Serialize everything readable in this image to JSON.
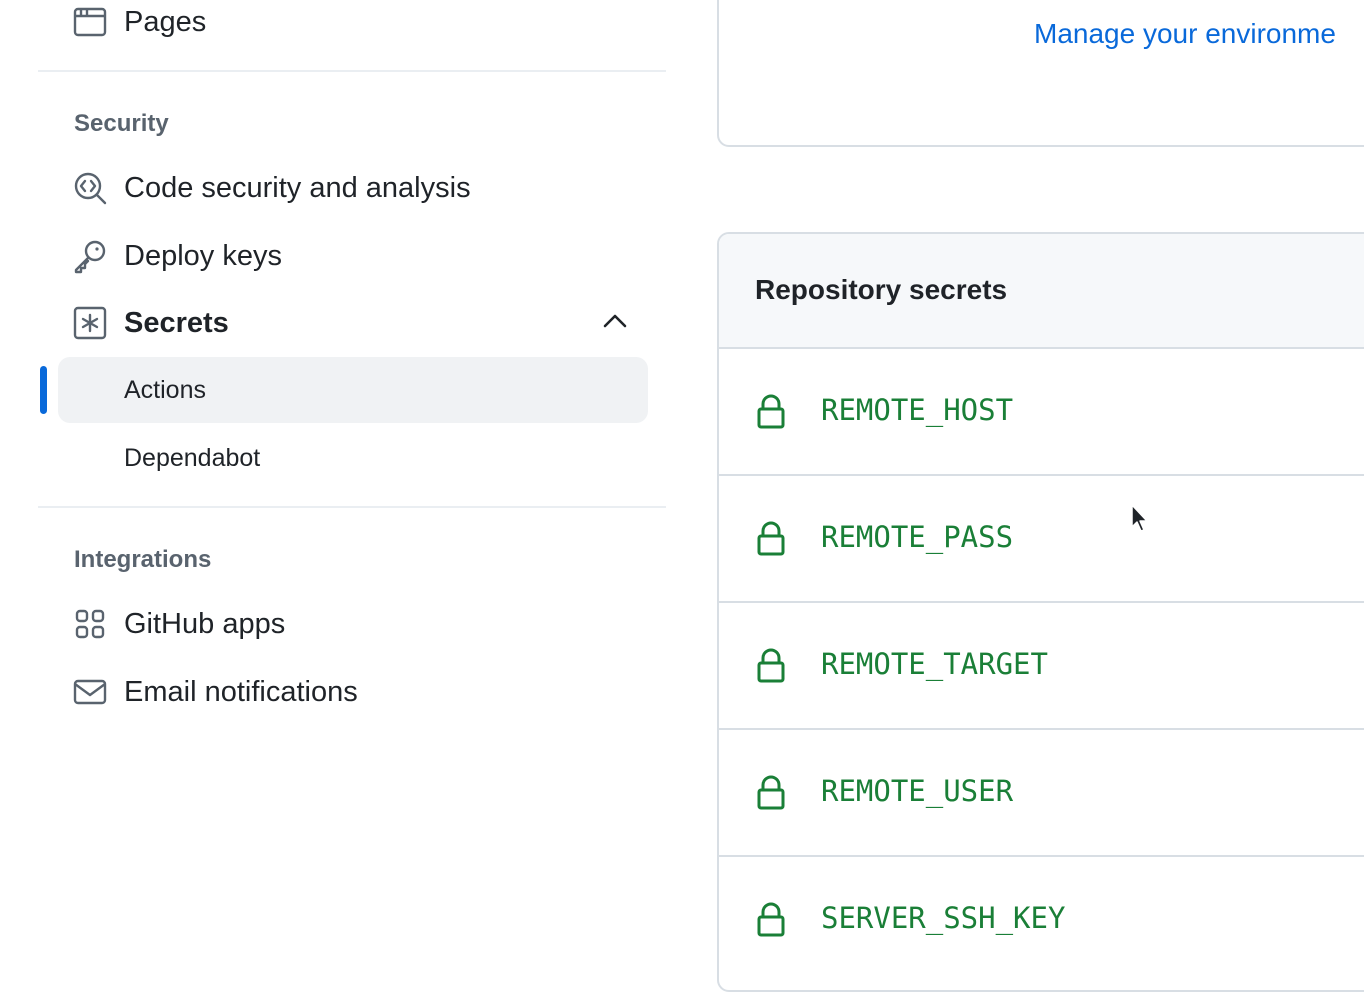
{
  "sidebar": {
    "pages_label": "Pages",
    "security_heading": "Security",
    "code_security_label": "Code security and analysis",
    "deploy_keys_label": "Deploy keys",
    "secrets_label": "Secrets",
    "secrets_sub": {
      "actions_label": "Actions",
      "dependabot_label": "Dependabot"
    },
    "integrations_heading": "Integrations",
    "github_apps_label": "GitHub apps",
    "email_notifications_label": "Email notifications"
  },
  "environments": {
    "manage_link": "Manage your environme"
  },
  "repository_secrets": {
    "title": "Repository secrets",
    "items": [
      {
        "name": "REMOTE_HOST"
      },
      {
        "name": "REMOTE_PASS"
      },
      {
        "name": "REMOTE_TARGET"
      },
      {
        "name": "REMOTE_USER"
      },
      {
        "name": "SERVER_SSH_KEY"
      }
    ]
  },
  "colors": {
    "link": "#0969da",
    "secret_name": "#1a7f37",
    "active_indicator": "#0969da",
    "active_bg": "#f0f2f4",
    "header_bg": "#f6f8fa",
    "border": "#d8dee4"
  }
}
